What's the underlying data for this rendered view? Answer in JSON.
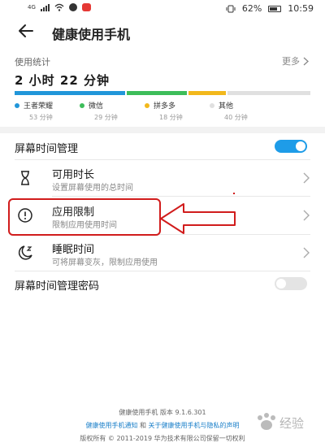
{
  "status_bar": {
    "signal_label": "4G",
    "battery": "62%",
    "time": "10:59"
  },
  "header": {
    "title": "健康使用手机"
  },
  "usage": {
    "label": "使用统计",
    "more": "更多",
    "total": "2 小时 22 分钟",
    "apps": [
      {
        "name": "王者荣耀",
        "time": "53 分钟",
        "minutes": 53,
        "color": "#2196d9"
      },
      {
        "name": "微信",
        "time": "29 分钟",
        "minutes": 29,
        "color": "#3dbd5a"
      },
      {
        "name": "拼多多",
        "time": "18 分钟",
        "minutes": 18,
        "color": "#f2b81c"
      },
      {
        "name": "其他",
        "time": "40 分钟",
        "minutes": 40,
        "color": "#e0e0e0"
      }
    ]
  },
  "screen_time": {
    "label": "屏幕时间管理",
    "enabled": true
  },
  "items": [
    {
      "title": "可用时长",
      "subtitle": "设置屏幕使用的总时间",
      "icon": "hourglass-icon"
    },
    {
      "title": "应用限制",
      "subtitle": "限制应用使用时间",
      "icon": "alert-circle-icon"
    },
    {
      "title": "睡眠时间",
      "subtitle": "可将屏幕变灰，限制应用使用",
      "icon": "moon-sleep-icon"
    }
  ],
  "password": {
    "label": "屏幕时间管理密码",
    "enabled": false
  },
  "footer": {
    "version": "健康使用手机 版本 9.1.6.301",
    "link_notice": "健康使用手机通知",
    "and": "和",
    "link_privacy": "关于健康使用手机与隐私的声明",
    "copyright": "版权所有 © 2011-2019 华为技术有限公司保留一切权利"
  },
  "watermark": "百经验",
  "colors": {
    "accent": "#1e9ce8",
    "annotation": "#d11c1c"
  }
}
